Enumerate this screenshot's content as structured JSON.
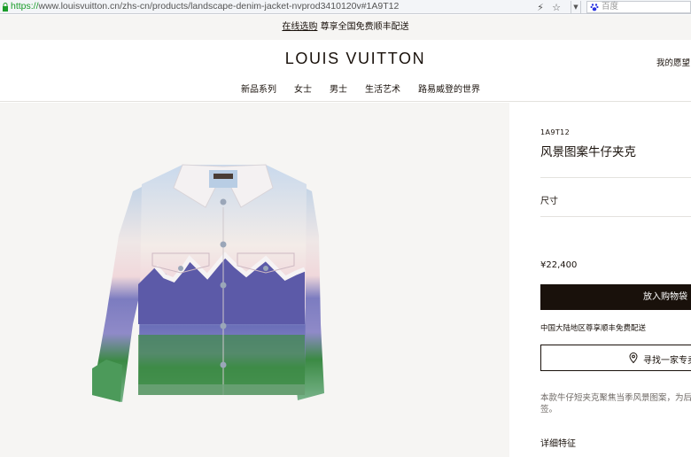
{
  "browser": {
    "url_scheme": "https://",
    "url_rest": "www.louisvuitton.cn/zhs-cn/products/landscape-denim-jacket-nvprod3410120v#1A9T12",
    "search_placeholder": "百度"
  },
  "promo": {
    "link": "在线选购",
    "text": " 尊享全国免费顺丰配送"
  },
  "header": {
    "logo": "LOUIS VUITTON",
    "wishlist": "我的愿望",
    "nav": [
      "新品系列",
      "女士",
      "男士",
      "生活艺术",
      "路易威登的世界"
    ]
  },
  "product": {
    "sku": "1A9T12",
    "name": "风景图案牛仔夹克",
    "size_label": "尺寸",
    "price": "¥22,400",
    "add_to_cart": "放入购物袋",
    "shipping": "中国大陆地区尊享顺丰免费配送",
    "find_store": "寻找一家专卖",
    "description_line1": "本款牛仔短夹克聚焦当季风景图案，为后摆",
    "description_line2": "签。",
    "details_label": "详细特征"
  },
  "colors": {
    "text": "#19110b",
    "secure_green": "#1a9c2a",
    "image_bg": "#f6f5f3"
  }
}
